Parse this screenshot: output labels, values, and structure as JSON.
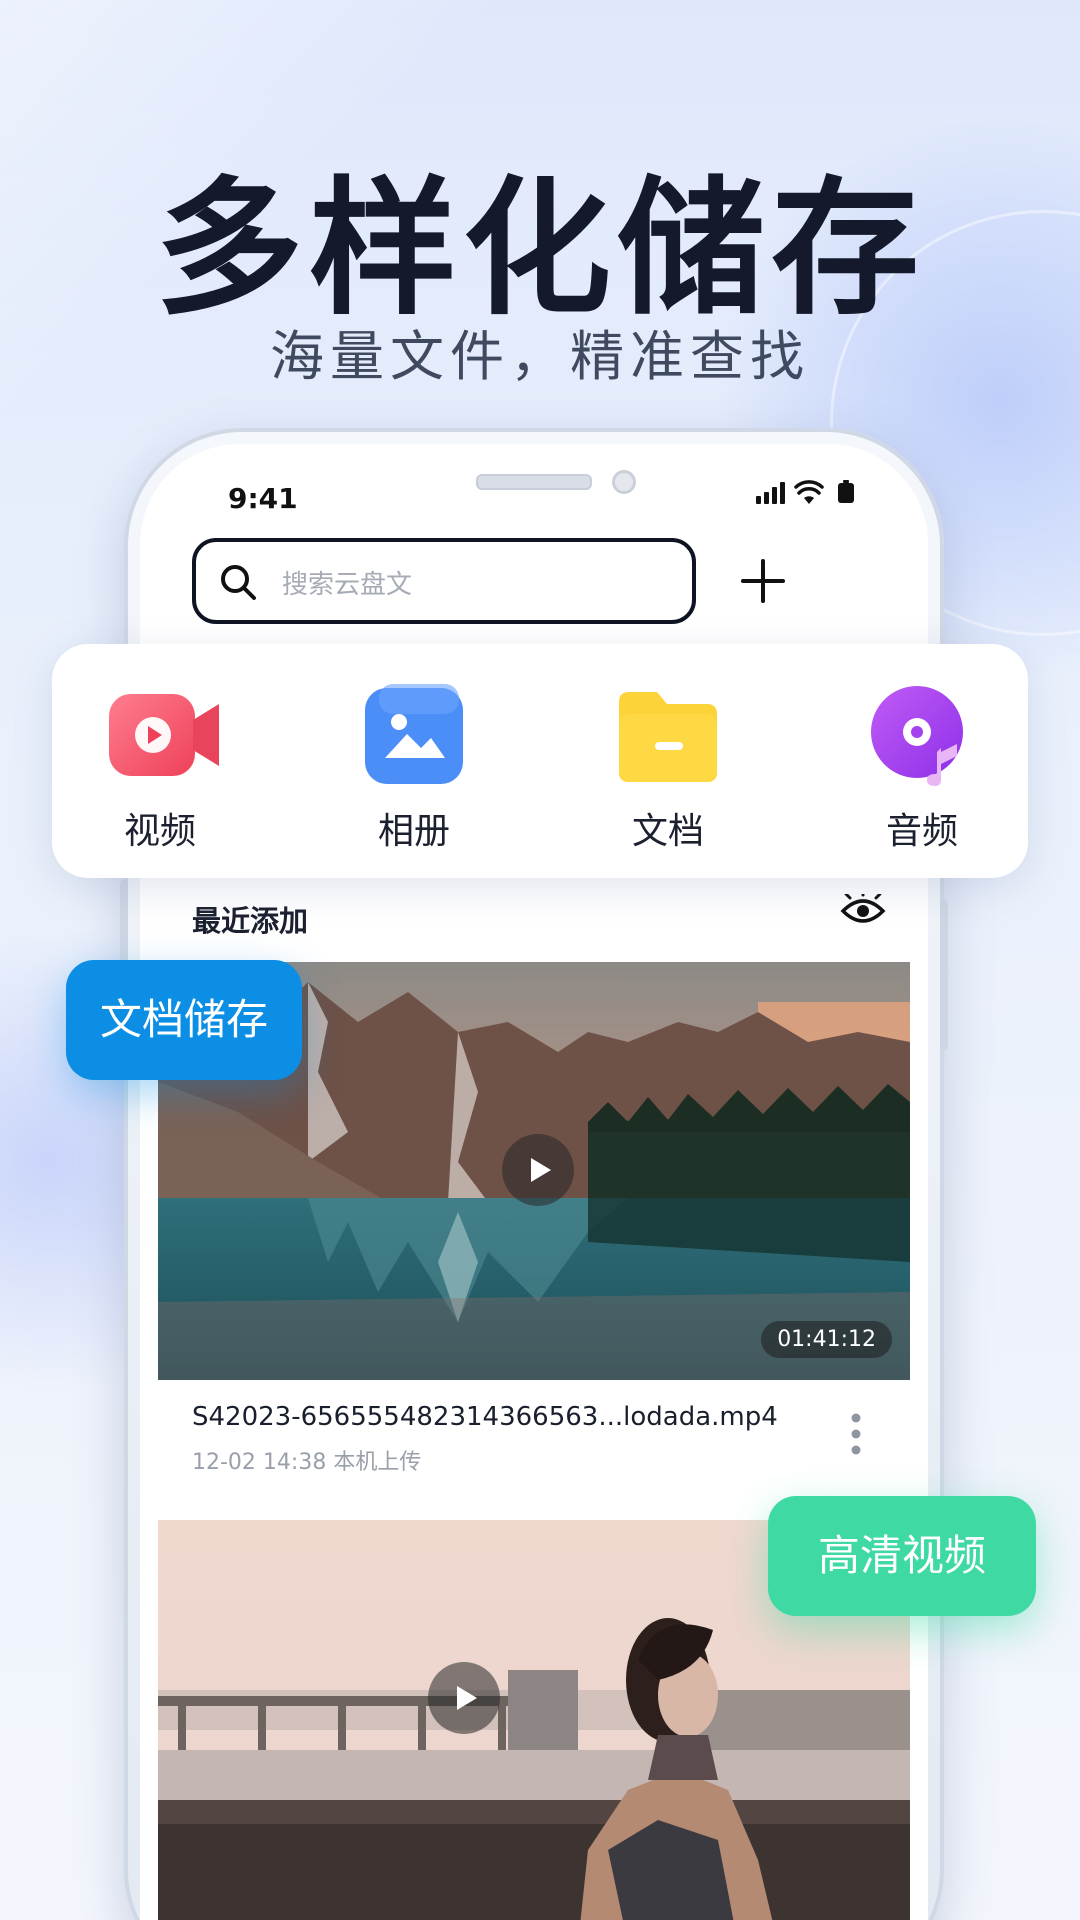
{
  "hero": {
    "title": "多样化储存",
    "subtitle": "海量文件，精准查找"
  },
  "statusbar": {
    "time": "9:41",
    "icons": [
      "signal-icon",
      "wifi-icon",
      "battery-icon"
    ]
  },
  "search": {
    "placeholder": "搜索云盘文",
    "icon": "search-icon",
    "add_icon": "plus-icon"
  },
  "categories": [
    {
      "label": "视频",
      "icon": "video-icon",
      "color": "#f0566b"
    },
    {
      "label": "相册",
      "icon": "photo-icon",
      "color": "#4c8ef7"
    },
    {
      "label": "文档",
      "icon": "folder-icon",
      "color": "#fdd33a"
    },
    {
      "label": "音频",
      "icon": "music-disc-icon",
      "color": "#a442f0"
    }
  ],
  "recent": {
    "title": "最近添加",
    "toggle_icon": "eye-icon"
  },
  "videos": [
    {
      "name": "S42023-656555482314366563...lodada.mp4",
      "meta": "12-02 14:38 本机上传",
      "duration": "01:41:12",
      "scene": "mountain-lake"
    },
    {
      "scene": "woman-by-river"
    }
  ],
  "badges": {
    "doc_storage": "文档储存",
    "hd_video": "高清视频"
  },
  "colors": {
    "badge_doc": "#0b8ee3",
    "badge_hd": "#3fd9a3",
    "headline": "#141a2b"
  }
}
